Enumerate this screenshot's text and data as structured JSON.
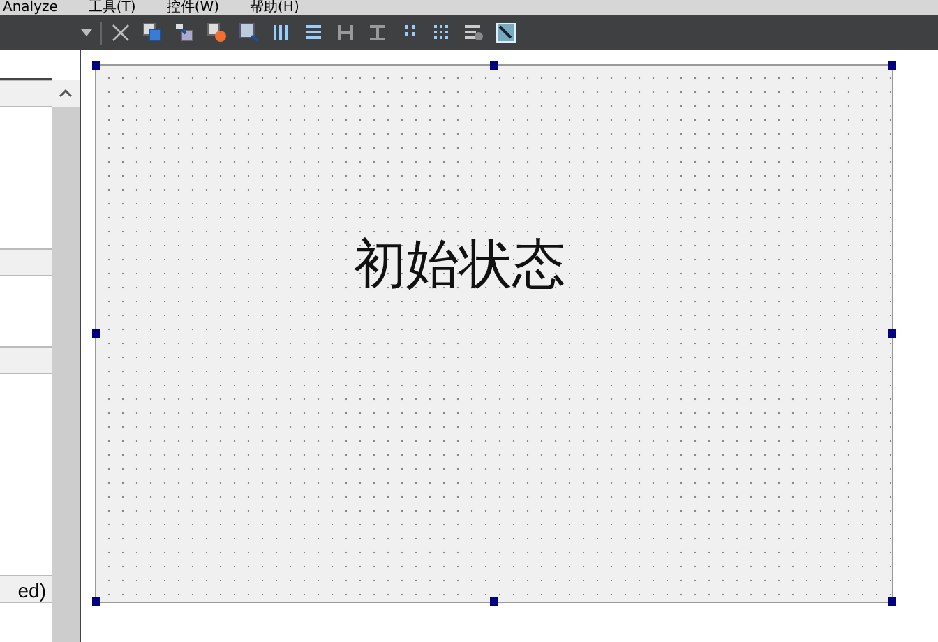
{
  "menu": [
    "Analyze",
    "工具(T)",
    "控件(W)",
    "帮助(H)"
  ],
  "property_headers": [
    {
      "kind": "blank"
    },
    {
      "kind": "blank"
    },
    {
      "kind": "blank"
    },
    {
      "kind": "text",
      "label": "ed)"
    }
  ],
  "form": {
    "label": "初始状态",
    "selected": true
  }
}
